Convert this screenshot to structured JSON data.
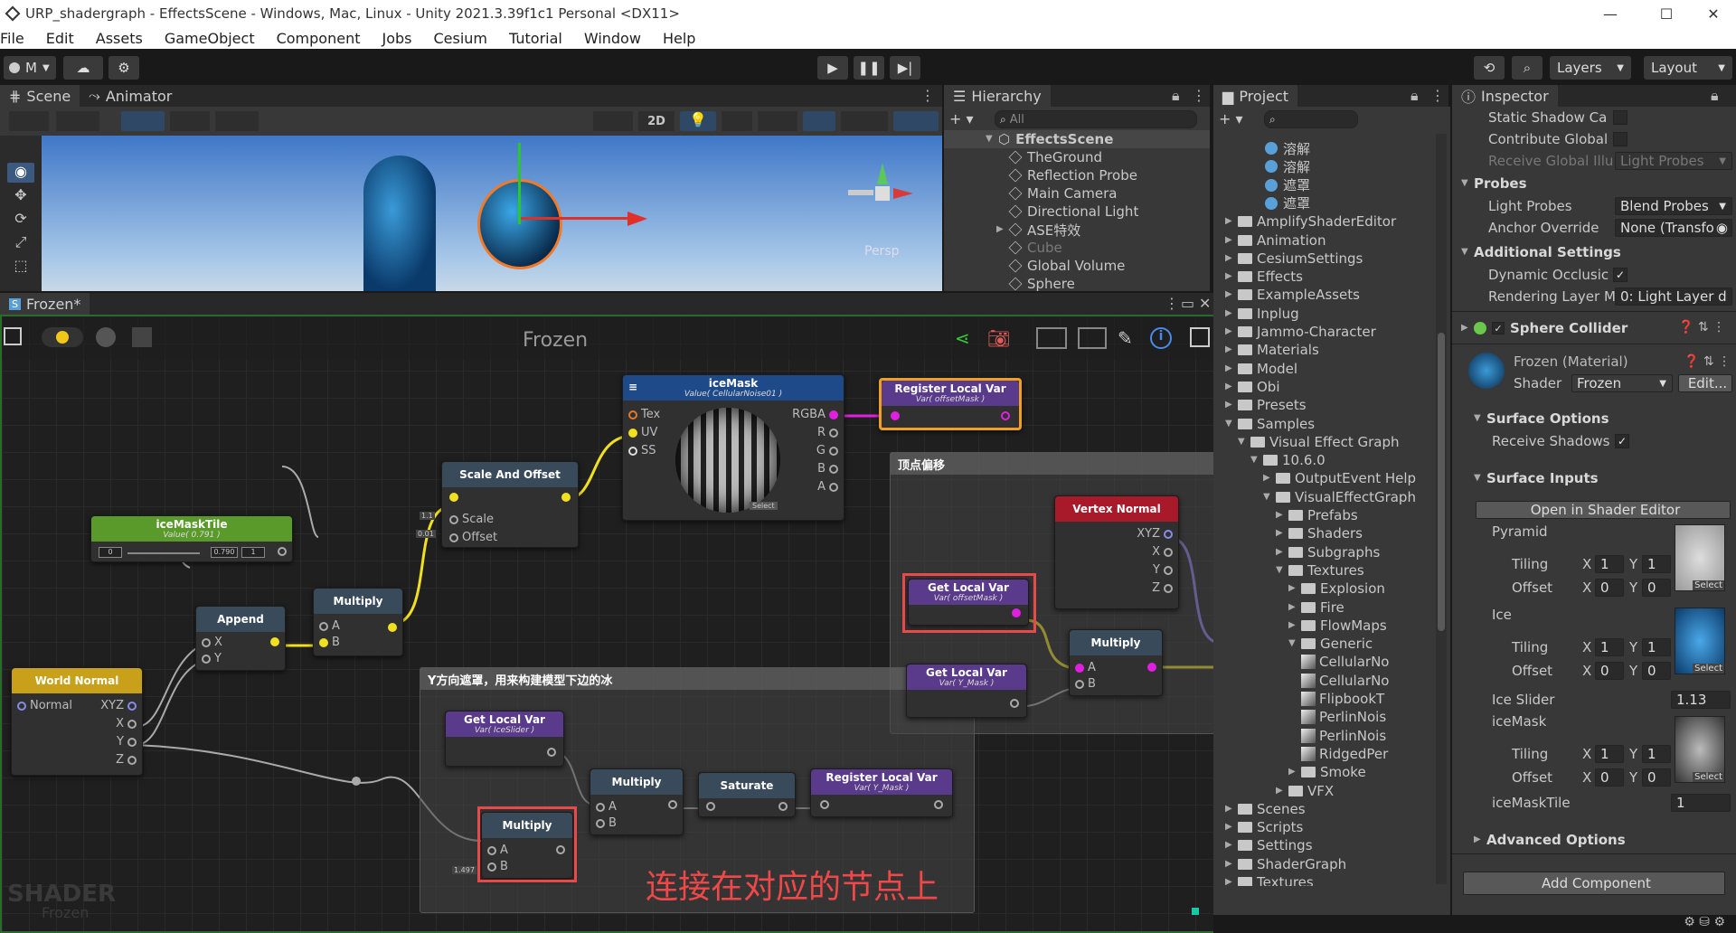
{
  "window": {
    "title": "URP_shadergraph - EffectsScene - Windows, Mac, Linux - Unity 2021.3.39f1c1 Personal <DX11>",
    "minimize": "—",
    "maximize": "☐",
    "close": "✕"
  },
  "menu": [
    "File",
    "Edit",
    "Assets",
    "GameObject",
    "Component",
    "Jobs",
    "Cesium",
    "Tutorial",
    "Window",
    "Help"
  ],
  "toolbar": {
    "account": "M",
    "layers": "Layers",
    "layout": "Layout"
  },
  "scene": {
    "tab_scene": "Scene",
    "tab_animator": "Animator",
    "btn_2d": "2D",
    "persp": "Persp"
  },
  "hierarchy": {
    "title": "Hierarchy",
    "search_placeholder": "All",
    "root": "EffectsScene",
    "items": [
      "TheGround",
      "Reflection Probe",
      "Main Camera",
      "Directional Light",
      "ASE特效",
      "Cube",
      "Global Volume",
      "Sphere"
    ]
  },
  "project": {
    "title": "Project",
    "top_items": [
      "溶解",
      "溶解",
      "遮罩",
      "遮罩"
    ],
    "tree": [
      {
        "label": "AmplifyShaderEditor",
        "depth": 0
      },
      {
        "label": "Animation",
        "depth": 0
      },
      {
        "label": "CesiumSettings",
        "depth": 0
      },
      {
        "label": "Effects",
        "depth": 0
      },
      {
        "label": "ExampleAssets",
        "depth": 0
      },
      {
        "label": "Inplug",
        "depth": 0
      },
      {
        "label": "Jammo-Character",
        "depth": 0
      },
      {
        "label": "Materials",
        "depth": 0
      },
      {
        "label": "Model",
        "depth": 0
      },
      {
        "label": "Obi",
        "depth": 0
      },
      {
        "label": "Presets",
        "depth": 0
      },
      {
        "label": "Samples",
        "depth": 0,
        "open": true
      },
      {
        "label": "Visual Effect Graph",
        "depth": 1,
        "open": true
      },
      {
        "label": "10.6.0",
        "depth": 2,
        "open": true
      },
      {
        "label": "OutputEvent Help",
        "depth": 3
      },
      {
        "label": "VisualEffectGraph",
        "depth": 3,
        "open": true
      },
      {
        "label": "Prefabs",
        "depth": 4
      },
      {
        "label": "Shaders",
        "depth": 4
      },
      {
        "label": "Subgraphs",
        "depth": 4
      },
      {
        "label": "Textures",
        "depth": 4,
        "open": true
      },
      {
        "label": "Explosion",
        "depth": 5
      },
      {
        "label": "Fire",
        "depth": 5
      },
      {
        "label": "FlowMaps",
        "depth": 5
      },
      {
        "label": "Generic",
        "depth": 5,
        "open": true
      },
      {
        "label": "CellularNo",
        "depth": 6,
        "tex": true
      },
      {
        "label": "CellularNo",
        "depth": 6,
        "tex": true
      },
      {
        "label": "FlipbookT",
        "depth": 6,
        "tex": true
      },
      {
        "label": "PerlinNois",
        "depth": 6,
        "tex": true
      },
      {
        "label": "PerlinNois",
        "depth": 6,
        "tex": true
      },
      {
        "label": "RidgedPer",
        "depth": 6,
        "tex": true
      },
      {
        "label": "Smoke",
        "depth": 5
      },
      {
        "label": "VFX",
        "depth": 4
      },
      {
        "label": "Scenes",
        "depth": 0
      },
      {
        "label": "Scripts",
        "depth": 0
      },
      {
        "label": "Settings",
        "depth": 0
      },
      {
        "label": "ShaderGraph",
        "depth": 0
      },
      {
        "label": "Textures",
        "depth": 0
      }
    ]
  },
  "inspector": {
    "title": "Inspector",
    "static_shadow": "Static Shadow Ca",
    "contribute_global": "Contribute Global",
    "receive_global": "Receive Global Illu",
    "receive_global_val": "Light Probes",
    "probes": "Probes",
    "light_probes": "Light Probes",
    "light_probes_val": "Blend Probes",
    "anchor": "Anchor Override",
    "anchor_val": "None (Transfo",
    "additional": "Additional Settings",
    "dynamic": "Dynamic Occlusic",
    "rendering_layer": "Rendering Layer M",
    "rendering_layer_val": "0: Light Layer d",
    "sphere_collider": "Sphere Collider",
    "material": "Frozen (Material)",
    "shader_label": "Shader",
    "shader_val": "Frozen",
    "edit": "Edit...",
    "surface_options": "Surface Options",
    "receive_shadows": "Receive Shadows",
    "surface_inputs": "Surface Inputs",
    "open_editor": "Open in Shader Editor",
    "pyramid": "Pyramid",
    "ice": "Ice",
    "tiling": "Tiling",
    "offset": "Offset",
    "x": "X",
    "y": "Y",
    "one": "1",
    "zero": "0",
    "select": "Select",
    "ice_slider": "Ice Slider",
    "ice_slider_val": "1.13",
    "icemask": "iceMask",
    "icemasktile": "iceMaskTile",
    "icemasktile_val": "1",
    "advanced": "Advanced Options",
    "add_component": "Add Component"
  },
  "graph": {
    "tab": "Frozen*",
    "title": "Frozen",
    "watermark": "SHADER",
    "watermark_sub": "Frozen",
    "annotation": "连接在对应的节点上",
    "group_top": "顶点偏移",
    "group_bottom": "Y方向遮罩，用来构建模型下边的冰",
    "nodes": {
      "icemask": {
        "title": "iceMask",
        "sub": "Value( CellularNoise01 )",
        "tex": "Tex",
        "uv": "UV",
        "ss": "SS",
        "rgba": "RGBA",
        "r": "R",
        "g": "G",
        "b": "B",
        "a": "A",
        "select": "Select"
      },
      "reg1": {
        "title": "Register Local Var",
        "sub": "Var( offsetMask )"
      },
      "scale": {
        "title": "Scale And Offset",
        "scale": "Scale",
        "offset": "Offset",
        "v1": "1.1",
        "v0": "0.01"
      },
      "tile": {
        "title": "iceMaskTile",
        "sub": "Value( 0.791 )",
        "val": "0.790",
        "one": "1",
        "zero": "0"
      },
      "append": {
        "title": "Append",
        "x": "X",
        "y": "Y"
      },
      "mul1": {
        "title": "Multiply",
        "a": "A",
        "b": "B"
      },
      "world": {
        "title": "World Normal",
        "normal": "Normal",
        "xyz": "XYZ",
        "x": "X",
        "y": "Y",
        "z": "Z"
      },
      "vnorm": {
        "title": "Vertex Normal",
        "xyz": "XYZ",
        "x": "X",
        "y": "Y",
        "z": "Z"
      },
      "get1": {
        "title": "Get Local Var",
        "sub": "Var( offsetMask )"
      },
      "mul2": {
        "title": "Multiply",
        "a": "A",
        "b": "B"
      },
      "get2": {
        "title": "Get Local Var",
        "sub": "Var( Y_Mask )"
      },
      "get3": {
        "title": "Get Local Var",
        "sub": "Var( IceSlider )"
      },
      "mul3": {
        "title": "Multiply",
        "a": "A",
        "b": "B"
      },
      "sat": {
        "title": "Saturate"
      },
      "reg2": {
        "title": "Register Local Var",
        "sub": "Var( Y_Mask )"
      },
      "mul4": {
        "title": "Multiply",
        "a": "A",
        "b": "B",
        "v": "1.497"
      }
    }
  }
}
